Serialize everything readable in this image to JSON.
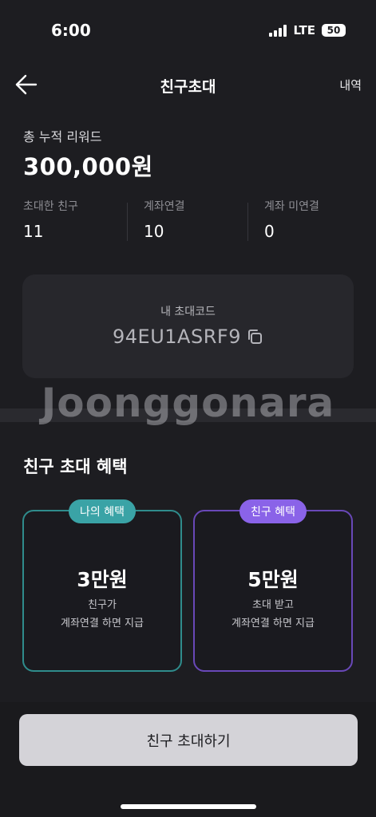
{
  "status_bar": {
    "time": "6:00",
    "network": "LTE",
    "battery": "50"
  },
  "header": {
    "title": "친구초대",
    "history_label": "내역"
  },
  "reward": {
    "label": "총 누적 리워드",
    "amount": "300,000원"
  },
  "stats": [
    {
      "label": "초대한 친구",
      "value": "11"
    },
    {
      "label": "계좌연결",
      "value": "10"
    },
    {
      "label": "계좌 미연결",
      "value": "0"
    }
  ],
  "invite_code": {
    "label": "내 초대코드",
    "code": "94EU1ASRF9"
  },
  "watermark": "Joonggonara",
  "benefits": {
    "title": "친구 초대 혜택",
    "mine": {
      "badge": "나의 혜택",
      "amount": "3만원",
      "line1": "친구가",
      "line2": "계좌연결 하면 지급"
    },
    "friend": {
      "badge": "친구 혜택",
      "amount": "5만원",
      "line1": "초대 받고",
      "line2": "계좌연결 하면 지급"
    }
  },
  "cta": {
    "label": "친구 초대하기"
  },
  "colors": {
    "background": "#1d1d21",
    "mine_accent": "#3aa3a6",
    "friend_accent": "#8a63e8",
    "button": "#d4d3d8"
  },
  "icons": {
    "back": "arrow-left-icon",
    "copy": "copy-icon"
  }
}
